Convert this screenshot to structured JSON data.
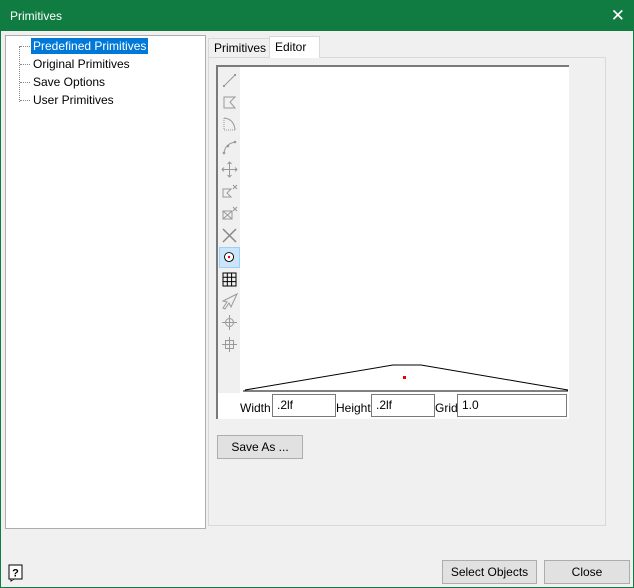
{
  "window": {
    "title": "Primitives",
    "accent": "#107c41"
  },
  "tree": {
    "items": [
      {
        "label": "Predefined Primitives",
        "selected": true
      },
      {
        "label": "Original Primitives"
      },
      {
        "label": "Save Options"
      },
      {
        "label": "User Primitives"
      }
    ]
  },
  "tabs": [
    {
      "label": "Primitives"
    },
    {
      "label": "Editor",
      "active": true
    }
  ],
  "editor": {
    "tools": [
      "line-icon",
      "polygon-icon",
      "arc-dotted-icon",
      "curve-icon",
      "move-icon",
      "delete-point-icon",
      "delete-box-icon",
      "cross-icon",
      "center-point-icon",
      "grid-icon",
      "pointer-icon",
      "crosshair-circle-icon",
      "crosshair-icon"
    ],
    "selected_tool": "center-point-icon",
    "width_label": "Width",
    "width_value": ".2lf",
    "height_label": "Height",
    "height_value": ".2lf",
    "grid_label": "Grid",
    "grid_value": "1.0"
  },
  "buttons": {
    "save_as": "Save As ...",
    "select_objects": "Select Objects",
    "close": "Close"
  }
}
